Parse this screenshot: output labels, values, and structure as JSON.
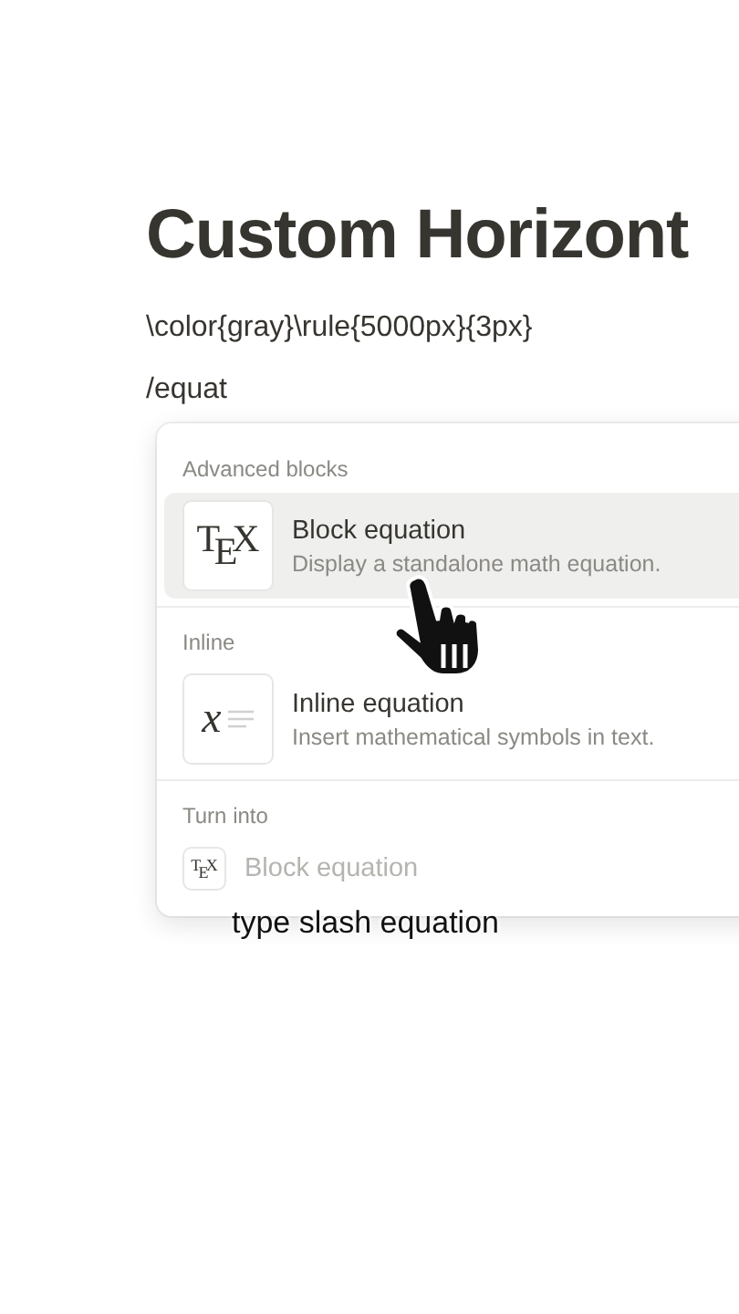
{
  "page": {
    "title": "Custom Horizont",
    "lines": [
      "\\color{gray}\\rule{5000px}{3px}",
      "/equat"
    ]
  },
  "menu": {
    "sections": [
      {
        "heading": "Advanced blocks",
        "kind": "full",
        "items": [
          {
            "title": "Block equation",
            "description": "Display a standalone math equation.",
            "kind": "tex",
            "glyph": "T$_{E}$X",
            "selected": true
          }
        ]
      },
      {
        "heading": "Inline",
        "kind": "full",
        "items": [
          {
            "title": "Inline equation",
            "description": "Insert mathematical symbols in text.",
            "kind": "inline",
            "glyph": "x",
            "selected": false
          }
        ]
      },
      {
        "heading": "Turn into",
        "kind": "compact",
        "items": [
          {
            "title": "Block equation",
            "kind": "tex",
            "glyph": "T$_{E}$X",
            "selected": false
          }
        ]
      }
    ]
  },
  "caption": "type slash equation"
}
